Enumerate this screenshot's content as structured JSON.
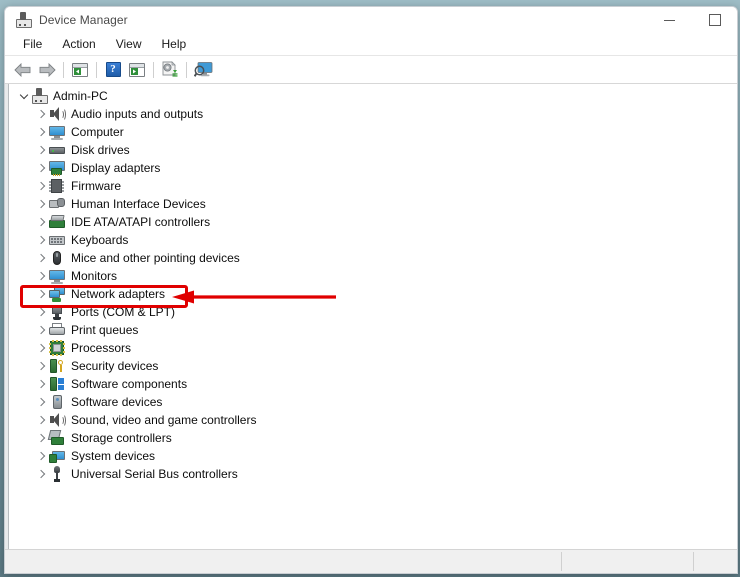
{
  "window": {
    "title": "Device Manager",
    "icon": "device-manager-icon",
    "controls": {
      "minimize": "Minimize",
      "maximize": "Maximize"
    }
  },
  "menubar": {
    "items": [
      {
        "label": "File"
      },
      {
        "label": "Action"
      },
      {
        "label": "View"
      },
      {
        "label": "Help"
      }
    ]
  },
  "toolbar": {
    "buttons": [
      {
        "name": "back-button",
        "icon": "back-arrow-icon",
        "label": "Back"
      },
      {
        "name": "forward-button",
        "icon": "forward-arrow-icon",
        "label": "Forward"
      },
      {
        "name": "show-hide-console-tree-button",
        "icon": "console-tree-icon",
        "label": "Show/Hide Console Tree"
      },
      {
        "name": "help-button",
        "icon": "help-question-icon",
        "label": "Help"
      },
      {
        "name": "properties-button",
        "icon": "properties-icon",
        "label": "Properties"
      },
      {
        "name": "update-driver-button",
        "icon": "update-driver-icon",
        "label": "Update Driver Software"
      },
      {
        "name": "scan-hardware-changes-button",
        "icon": "scan-monitor-icon",
        "label": "Scan for hardware changes"
      }
    ]
  },
  "tree": {
    "root": {
      "label": "Admin-PC",
      "icon": "computer-root-icon",
      "expanded": true
    },
    "nodes": [
      {
        "label": "Audio inputs and outputs",
        "icon": "speaker-icon",
        "expanded": false
      },
      {
        "label": "Computer",
        "icon": "monitor-icon",
        "expanded": false
      },
      {
        "label": "Disk drives",
        "icon": "disk-drive-icon",
        "expanded": false
      },
      {
        "label": "Display adapters",
        "icon": "display-adapter-icon",
        "expanded": false
      },
      {
        "label": "Firmware",
        "icon": "firmware-chip-icon",
        "expanded": false
      },
      {
        "label": "Human Interface Devices",
        "icon": "hid-icon",
        "expanded": false
      },
      {
        "label": "IDE ATA/ATAPI controllers",
        "icon": "ide-controller-icon",
        "expanded": false
      },
      {
        "label": "Keyboards",
        "icon": "keyboard-icon",
        "expanded": false
      },
      {
        "label": "Mice and other pointing devices",
        "icon": "mouse-icon",
        "expanded": false
      },
      {
        "label": "Monitors",
        "icon": "monitor-icon",
        "expanded": false
      },
      {
        "label": "Network adapters",
        "icon": "network-adapter-icon",
        "expanded": false
      },
      {
        "label": "Ports (COM & LPT)",
        "icon": "port-icon",
        "expanded": false
      },
      {
        "label": "Print queues",
        "icon": "printer-icon",
        "expanded": false
      },
      {
        "label": "Processors",
        "icon": "processor-icon",
        "expanded": false
      },
      {
        "label": "Security devices",
        "icon": "security-device-icon",
        "expanded": false
      },
      {
        "label": "Software components",
        "icon": "software-component-icon",
        "expanded": false
      },
      {
        "label": "Software devices",
        "icon": "software-device-icon",
        "expanded": false
      },
      {
        "label": "Sound, video and game controllers",
        "icon": "speaker-icon",
        "expanded": false
      },
      {
        "label": "Storage controllers",
        "icon": "storage-controller-icon",
        "expanded": false
      },
      {
        "label": "System devices",
        "icon": "system-device-icon",
        "expanded": false
      },
      {
        "label": "Universal Serial Bus controllers",
        "icon": "usb-icon",
        "expanded": false
      }
    ]
  },
  "annotation": {
    "highlighted_item": "Network adapters",
    "color": "#e00000",
    "shape": "rectangle-with-left-pointing-arrow"
  },
  "statusbar": {
    "panes": [
      "",
      "",
      ""
    ]
  }
}
